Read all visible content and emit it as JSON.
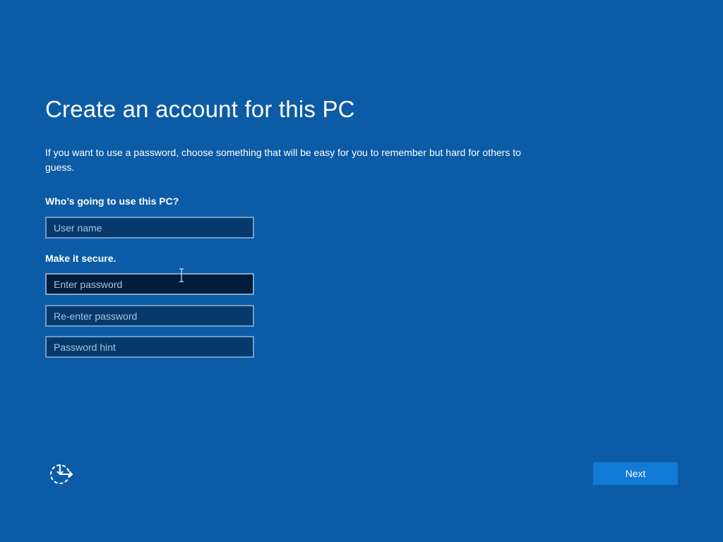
{
  "page": {
    "title": "Create an account for this PC",
    "description": "If you want to use a password, choose something that will be easy for you to remember but hard for others to guess."
  },
  "account": {
    "user_section_label": "Who’s going to use this PC?",
    "username_placeholder": "User name",
    "username_value": ""
  },
  "security": {
    "section_label": "Make it secure.",
    "password_placeholder": "Enter password",
    "reenter_placeholder": "Re-enter password",
    "hint_placeholder": "Password hint"
  },
  "footer": {
    "next_label": "Next",
    "ease_of_access_icon": "ease-of-access-icon"
  },
  "colors": {
    "background": "#0b5ba6",
    "field_background": "#063a6c",
    "field_focused_background": "#021c3b",
    "field_border": "#6f9cc9",
    "button": "#1179d6"
  }
}
